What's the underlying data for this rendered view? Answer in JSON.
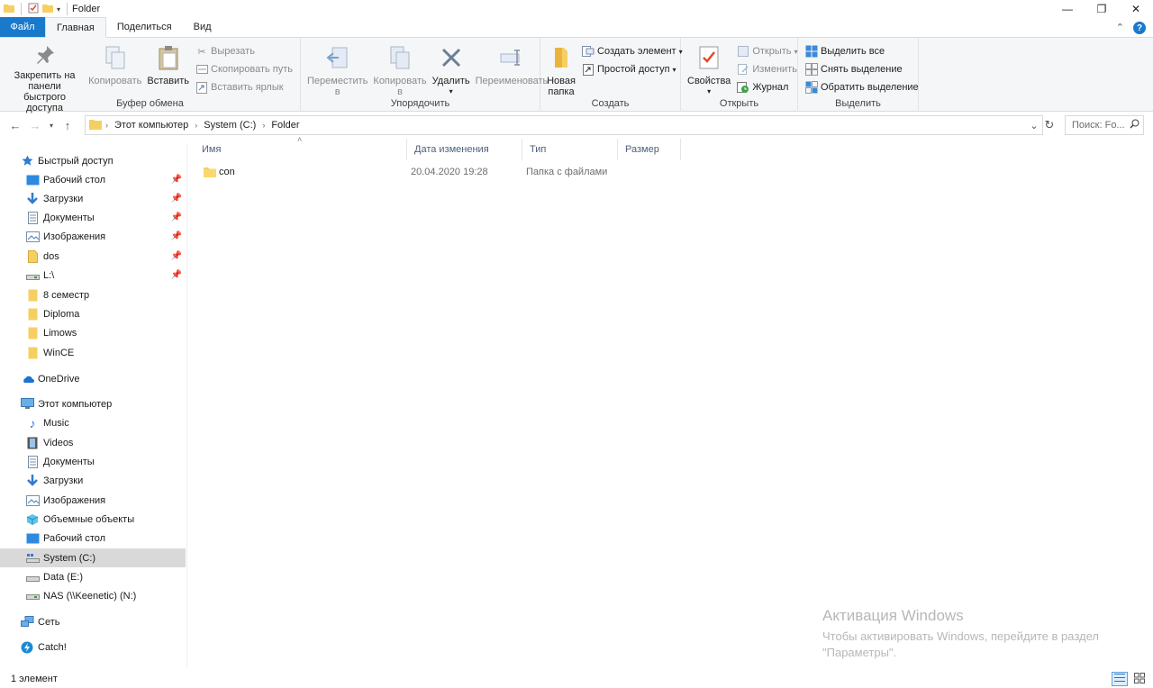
{
  "window": {
    "title": "Folder",
    "controls": {
      "minimize": "—",
      "maximize": "❐",
      "close": "✕"
    }
  },
  "ribbon_tabs": [
    "Файл",
    "Главная",
    "Поделиться",
    "Вид"
  ],
  "ribbon": {
    "clipboard": {
      "label": "Буфер обмена",
      "pin_line1": "Закрепить на панели",
      "pin_line2": "быстрого доступа",
      "copy": "Копировать",
      "paste": "Вставить",
      "cut": "Вырезать",
      "copy_path": "Скопировать путь",
      "paste_shortcut": "Вставить ярлык"
    },
    "organize": {
      "label": "Упорядочить",
      "move_to_line1": "Переместить",
      "move_to_line2": "в",
      "copy_to_line1": "Копировать",
      "copy_to_line2": "в",
      "delete": "Удалить",
      "rename": "Переименовать"
    },
    "create": {
      "label": "Создать",
      "new_folder_line1": "Новая",
      "new_folder_line2": "папка",
      "new_item": "Создать элемент",
      "easy_access": "Простой доступ"
    },
    "open": {
      "label": "Открыть",
      "properties": "Свойства",
      "open": "Открыть",
      "edit": "Изменить",
      "history": "Журнал"
    },
    "select": {
      "label": "Выделить",
      "select_all": "Выделить все",
      "select_none": "Снять выделение",
      "invert": "Обратить выделение"
    }
  },
  "address": {
    "crumbs": [
      "Этот компьютер",
      "System (C:)",
      "Folder"
    ],
    "search_placeholder": "Поиск: Fo..."
  },
  "sidebar": {
    "quick_access": "Быстрый доступ",
    "quick_items": [
      "Рабочий стол",
      "Загрузки",
      "Документы",
      "Изображения",
      "dos",
      "L:\\",
      "8 семестр",
      "Diploma",
      "Limows",
      "WinCE"
    ],
    "onedrive": "OneDrive",
    "this_pc": "Этот компьютер",
    "pc_items": [
      "Music",
      "Videos",
      "Документы",
      "Загрузки",
      "Изображения",
      "Объемные объекты",
      "Рабочий стол",
      "System (C:)",
      "Data (E:)",
      "NAS (\\\\Keenetic) (N:)"
    ],
    "network": "Сеть",
    "catch": "Catch!"
  },
  "columns": [
    "Имя",
    "Дата изменения",
    "Тип",
    "Размер"
  ],
  "files": [
    {
      "name": "con",
      "modified": "20.04.2020 19:28",
      "type": "Папка с файлами",
      "size": ""
    }
  ],
  "watermark": {
    "title": "Активация Windows",
    "line1": "Чтобы активировать Windows, перейдите в раздел",
    "line2": "\"Параметры\"."
  },
  "status": {
    "count": "1 элемент"
  },
  "colors": {
    "accent": "#1979ca",
    "folder": "#f6cf63",
    "selected_nav": "#d9d9d9"
  }
}
